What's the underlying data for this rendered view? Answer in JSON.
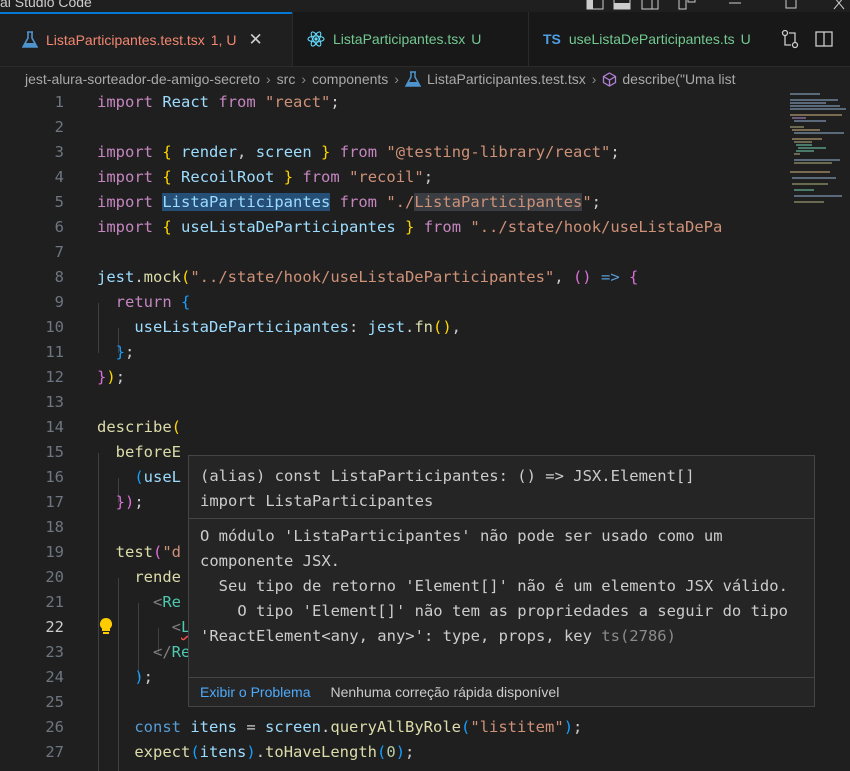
{
  "window": {
    "title": "al Studio Code"
  },
  "tabs": [
    {
      "name": "ListaParticipantes.test.tsx",
      "status": "1, U",
      "icon": "flask-icon",
      "active": true,
      "color": "#f48771"
    },
    {
      "name": "ListaParticipantes.tsx",
      "status": "U",
      "icon": "react-icon",
      "active": false,
      "color": "#73c991"
    },
    {
      "name": "useListaDeParticipantes.ts",
      "status": "U",
      "icon": "ts-icon",
      "icon_text": "TS",
      "active": false,
      "color": "#73c991"
    }
  ],
  "breadcrumb": [
    "jest-alura-sorteador-de-amigo-secreto",
    "src",
    "components",
    "ListaParticipantes.test.tsx",
    "describe(\"Uma list"
  ],
  "editor": {
    "current_line": 22,
    "line_numbers": [
      "1",
      "2",
      "3",
      "4",
      "5",
      "6",
      "7",
      "8",
      "9",
      "10",
      "11",
      "12",
      "13",
      "14",
      "15",
      "16",
      "17",
      "18",
      "19",
      "20",
      "21",
      "22",
      "23",
      "24",
      "25",
      "26",
      "27"
    ]
  },
  "hover": {
    "signature_line1": "(alias) const ListaParticipantes: () => JSX.Element[]",
    "signature_line2": "import ListaParticipantes",
    "message": "O módulo 'ListaParticipantes' não pode ser usado como um componente JSX.\n  Seu tipo de retorno 'Element[]' não é um elemento JSX válido.\n    O tipo 'Element[]' não tem as propriedades a seguir do tipo 'ReactElement<any, any>': type, props, key",
    "error_code": "ts(2786)",
    "view_problem": "Exibir o Problema",
    "no_quick_fix": "Nenhuma correção rápida disponível"
  },
  "colors": {
    "accent": "#0078d4",
    "modified_untracked": "#73c991",
    "error": "#f14c4c",
    "link": "#4daafc"
  }
}
